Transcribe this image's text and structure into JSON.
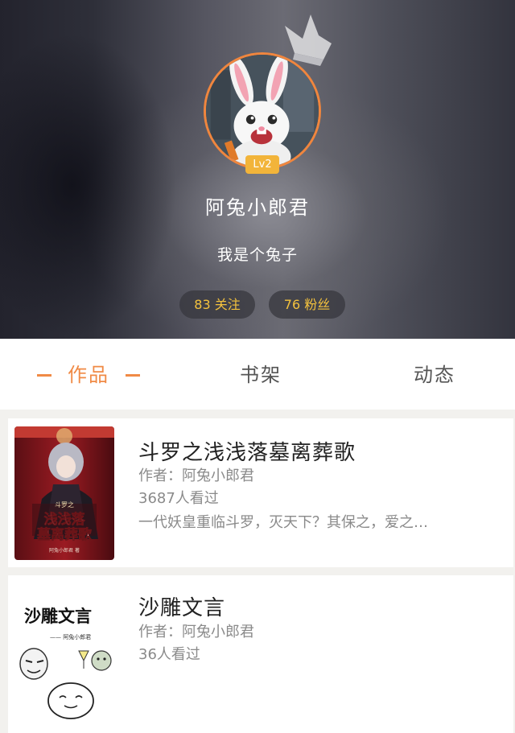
{
  "profile": {
    "level": "Lv2",
    "username": "阿兔小郎君",
    "bio": "我是个兔子",
    "following": "83 关注",
    "fans": "76 粉丝"
  },
  "tabs": [
    {
      "label": "作品",
      "active": true
    },
    {
      "label": "书架",
      "active": false
    },
    {
      "label": "动态",
      "active": false
    }
  ],
  "books": [
    {
      "title": "斗罗之浅浅落墓离葬歌",
      "author": "作者：阿兔小郎君",
      "views": "3687人看过",
      "description": "一代妖皇重临斗罗，灭天下？其保之，爱之…",
      "cover_text": "浅浅落墓离葬歌",
      "cover_small_text": "斗罗之",
      "cover_author": "阿兔小郎君 著"
    },
    {
      "title": "沙雕文言",
      "author": "作者：阿兔小郎君",
      "views": "36人看过",
      "cover_text": "沙雕文言",
      "cover_author": "—— 阿兔小郎君"
    }
  ],
  "colors": {
    "accent": "#f08a45",
    "level_badge": "#f2b43a",
    "stat_text": "#f4c23d"
  },
  "icons": [
    "crown-icon",
    "rabbit-avatar"
  ]
}
